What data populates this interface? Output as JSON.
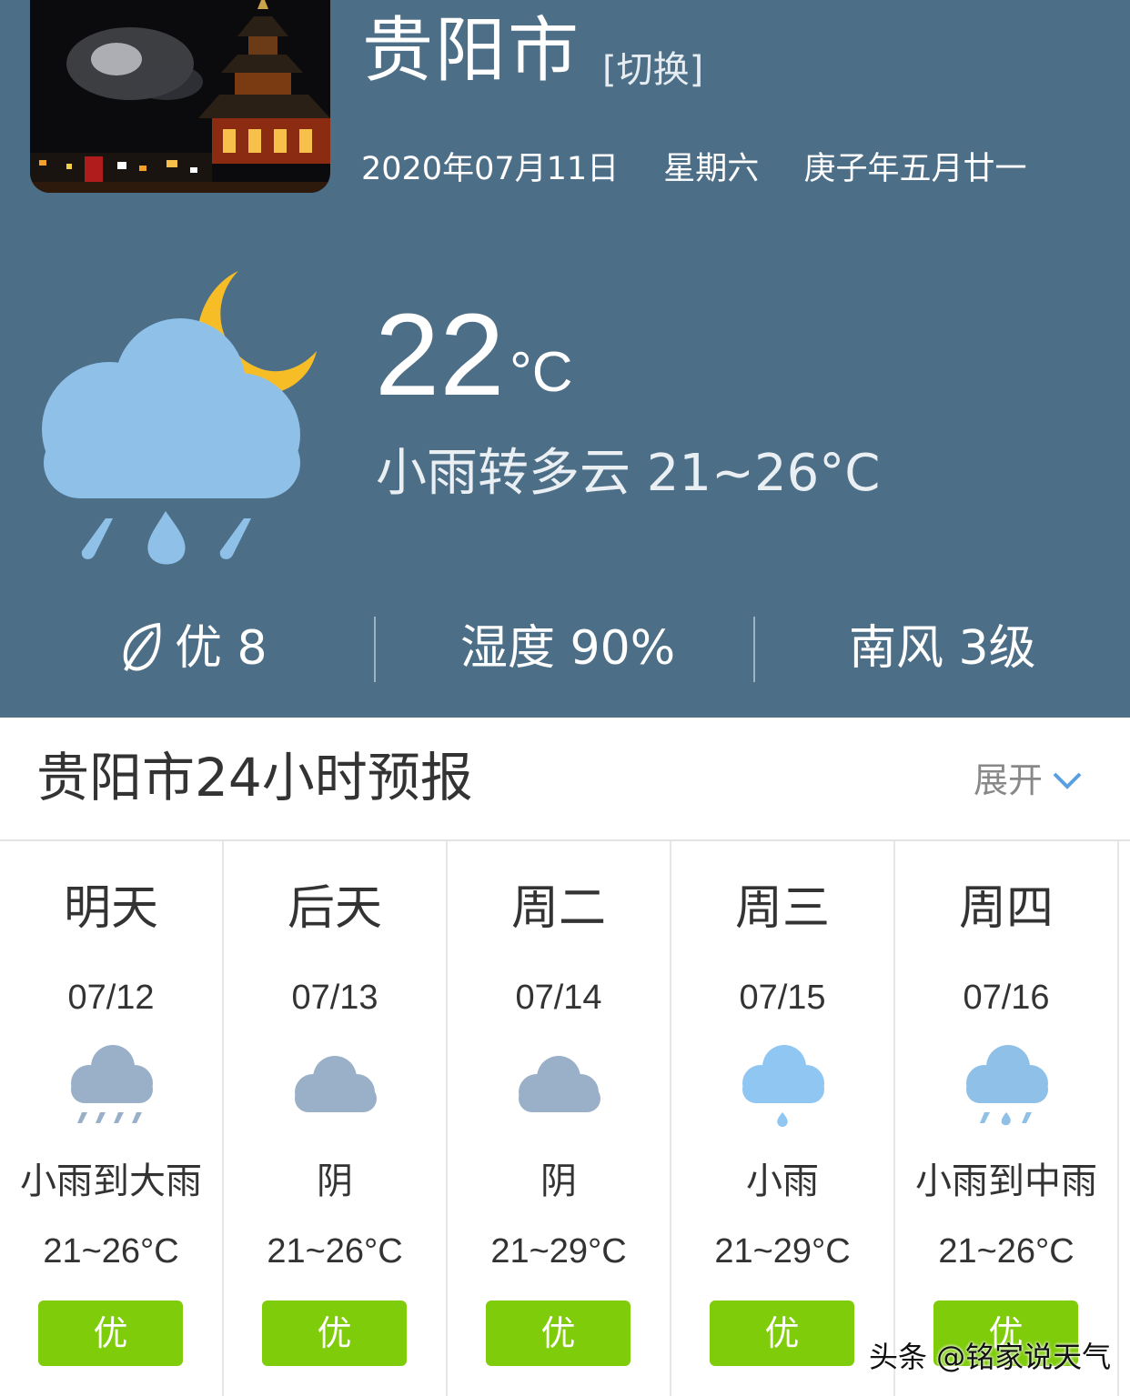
{
  "header": {
    "city": "贵阳市",
    "switch_label": "[切换]",
    "date": "2020年07月11日",
    "weekday": "星期六",
    "lunar_date": "庚子年五月廿一"
  },
  "current": {
    "icon": "light-rain-night-icon",
    "temperature": "22",
    "unit": "°C",
    "description": "小雨转多云 21~26°C"
  },
  "stats": {
    "air_quality": "优 8",
    "humidity": "湿度 90%",
    "wind": "南风 3级"
  },
  "forecast": {
    "title": "贵阳市24小时预报",
    "expand_label": "展开",
    "days": [
      {
        "name": "明天",
        "date": "07/12",
        "icon": "heavy-rain-icon",
        "condition": "小雨到大雨",
        "temp": "21~26°C",
        "aqi": "优"
      },
      {
        "name": "后天",
        "date": "07/13",
        "icon": "overcast-icon",
        "condition": "阴",
        "temp": "21~26°C",
        "aqi": "优"
      },
      {
        "name": "周二",
        "date": "07/14",
        "icon": "overcast-icon",
        "condition": "阴",
        "temp": "21~29°C",
        "aqi": "优"
      },
      {
        "name": "周三",
        "date": "07/15",
        "icon": "light-rain-icon",
        "condition": "小雨",
        "temp": "21~29°C",
        "aqi": "优"
      },
      {
        "name": "周四",
        "date": "07/16",
        "icon": "moderate-rain-icon",
        "condition": "小雨到中雨",
        "temp": "21~26°C",
        "aqi": "优"
      }
    ]
  },
  "colors": {
    "header_bg": "#4d6e87",
    "cloud": "#8fc0e8",
    "moon": "#f7bd27",
    "aqi_good": "#7fcc0b"
  },
  "watermark": "头条 @铭家说天气"
}
